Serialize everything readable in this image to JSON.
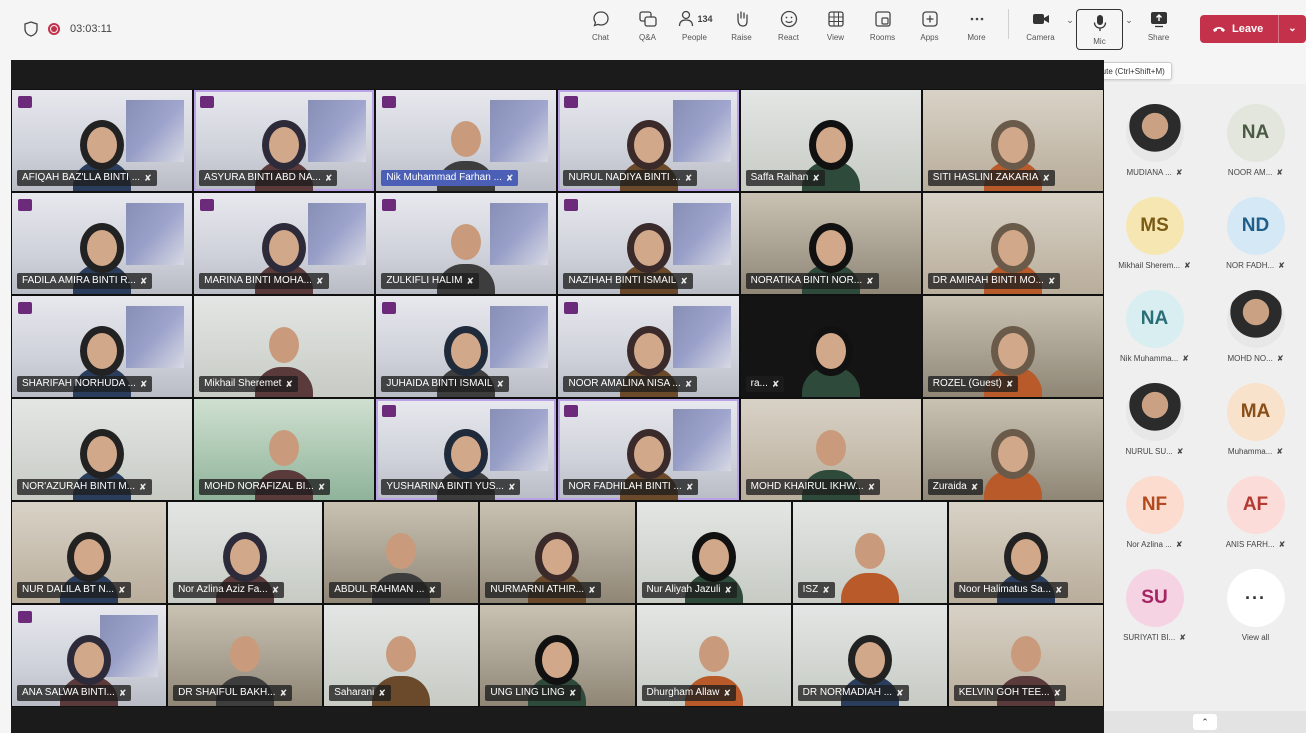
{
  "meeting": {
    "timer": "03:03:11",
    "tooltip": "Mute (Ctrl+Shift+M)"
  },
  "toolbar": {
    "chat": "Chat",
    "qa": "Q&A",
    "people": "People",
    "people_count": "134",
    "raise": "Raise",
    "react": "React",
    "view": "View",
    "rooms": "Rooms",
    "apps": "Apps",
    "more": "More",
    "camera": "Camera",
    "mic": "Mic",
    "share": "Share",
    "leave": "Leave"
  },
  "grid_top": [
    {
      "name": "AFIQAH BAZ'LLA BINTI ..."
    },
    {
      "name": "ASYURA BINTI ABD NA..."
    },
    {
      "name": "Nik Muhammad Farhan ..."
    },
    {
      "name": "NURUL NADIYA BINTI ..."
    },
    {
      "name": "Saffa Raihan"
    },
    {
      "name": "SITI HASLINI ZAKARIA"
    },
    {
      "name": "FADILA AMIRA BINTI R..."
    },
    {
      "name": "MARINA BINTI MOHA..."
    },
    {
      "name": "ZULKIFLI HALIM"
    },
    {
      "name": "NAZIHAH BINTI ISMAIL"
    },
    {
      "name": "NORATIKA BINTI NOR..."
    },
    {
      "name": "DR AMIRAH BINTI MO..."
    },
    {
      "name": "SHARIFAH NORHUDA ..."
    },
    {
      "name": "Mikhail Sheremet"
    },
    {
      "name": "JUHAIDA BINTI ISMAIL"
    },
    {
      "name": "NOOR AMALINA NISA ..."
    },
    {
      "name": "ra..."
    },
    {
      "name": "ROZEL (Guest)"
    },
    {
      "name": "NOR'AZURAH BINTI M..."
    },
    {
      "name": "MOHD NORAFIZAL BI..."
    },
    {
      "name": "YUSHARINA BINTI YUS..."
    },
    {
      "name": "NOR FADHILAH BINTI ..."
    },
    {
      "name": "MOHD KHAIRUL IKHW..."
    },
    {
      "name": "Zuraida"
    }
  ],
  "grid_bottom": [
    {
      "name": "NUR DALILA BT N..."
    },
    {
      "name": "Nor Azlina Aziz Fa..."
    },
    {
      "name": "ABDUL RAHMAN ..."
    },
    {
      "name": "NURMARNI ATHIR..."
    },
    {
      "name": "Nur Aliyah Jazuli"
    },
    {
      "name": "ISZ"
    },
    {
      "name": "Noor Halimatus Sa..."
    },
    {
      "name": "ANA SALWA BINTI..."
    },
    {
      "name": "DR SHAIFUL BAKH..."
    },
    {
      "name": "Saharani"
    },
    {
      "name": "UNG LING LING"
    },
    {
      "name": "Dhurgham Allaw"
    },
    {
      "name": "DR NORMADIAH ..."
    },
    {
      "name": "KELVIN GOH TEE..."
    }
  ],
  "roster": [
    {
      "initials": "",
      "name": "MUDIANA ...",
      "photo": true
    },
    {
      "initials": "NA",
      "name": "NOOR AM...",
      "bg": "#e2e6dc",
      "fg": "#4a5a45"
    },
    {
      "initials": "MS",
      "name": "Mikhail Sherem...",
      "bg": "#f6e7b2",
      "fg": "#7a5a14"
    },
    {
      "initials": "ND",
      "name": "NOR FADH...",
      "bg": "#d5e8f5",
      "fg": "#1f5f8a"
    },
    {
      "initials": "NA",
      "name": "Nik Muhamma...",
      "bg": "#d9eef0",
      "fg": "#2a6f78"
    },
    {
      "initials": "",
      "name": "MOHD NO...",
      "photo": true
    },
    {
      "initials": "",
      "name": "NURUL SU...",
      "photo": true
    },
    {
      "initials": "MA",
      "name": "Muhamma...",
      "bg": "#f9e2cc",
      "fg": "#8a4f18"
    },
    {
      "initials": "NF",
      "name": "Nor Azlina ...",
      "bg": "#fbdccf",
      "fg": "#b24a1e"
    },
    {
      "initials": "AF",
      "name": "ANIS FARH...",
      "bg": "#fbdcd8",
      "fg": "#b23a30"
    },
    {
      "initials": "SU",
      "name": "SURIYATI BI...",
      "bg": "#f6d3e3",
      "fg": "#a42663"
    },
    {
      "initials": "···",
      "name": "View all",
      "more": true
    }
  ]
}
